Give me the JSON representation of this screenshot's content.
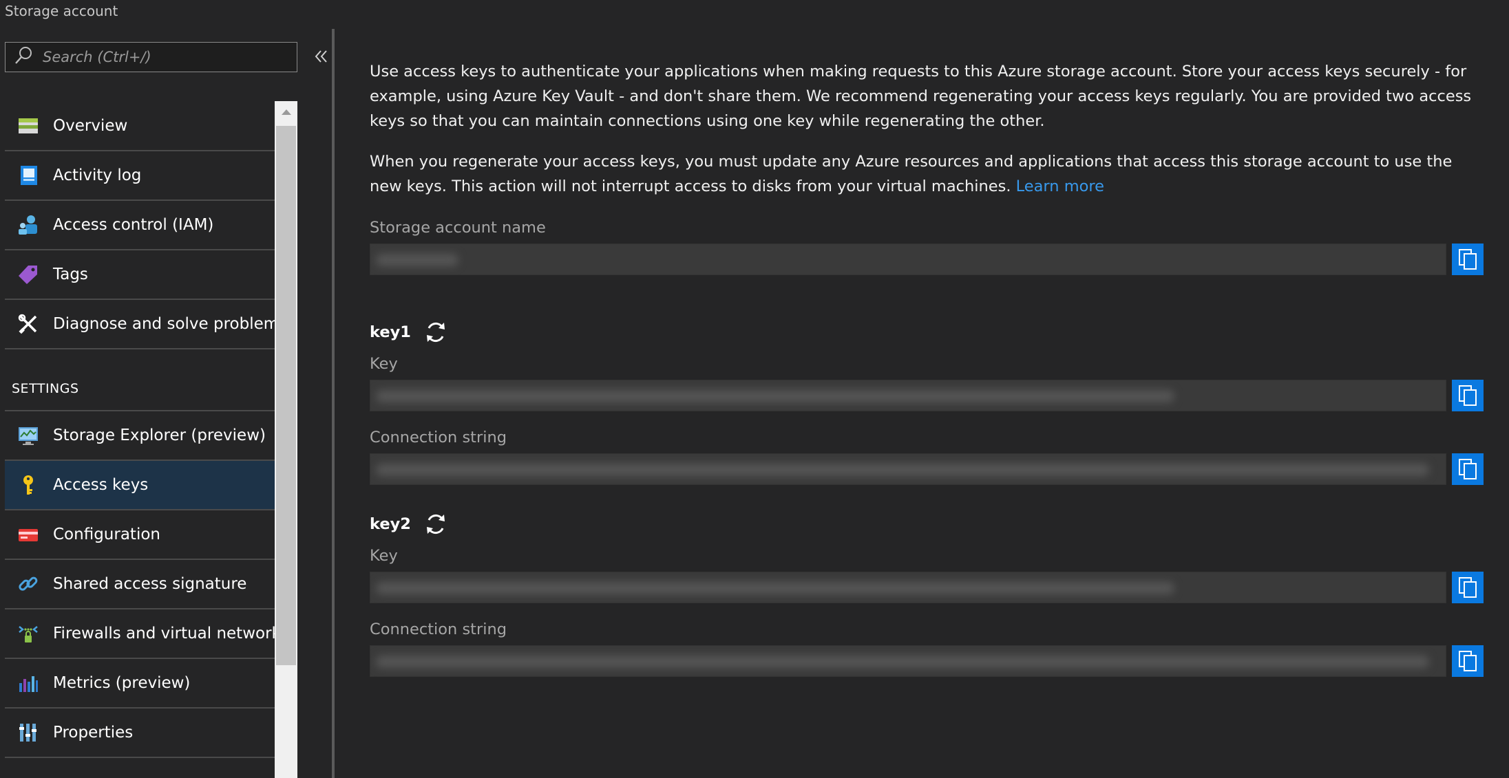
{
  "header": {
    "subtitle": "Storage account"
  },
  "search": {
    "placeholder": "Search (Ctrl+/)"
  },
  "menu": {
    "items_top": [
      {
        "label": "Overview",
        "icon": "overview-icon"
      },
      {
        "label": "Activity log",
        "icon": "activity-log-icon"
      },
      {
        "label": "Access control (IAM)",
        "icon": "iam-icon"
      },
      {
        "label": "Tags",
        "icon": "tag-icon"
      },
      {
        "label": "Diagnose and solve problems",
        "icon": "wrench-icon"
      }
    ],
    "settings_heading": "SETTINGS",
    "items_settings": [
      {
        "label": "Storage Explorer (preview)",
        "icon": "storage-explorer-icon"
      },
      {
        "label": "Access keys",
        "icon": "key-icon",
        "active": true
      },
      {
        "label": "Configuration",
        "icon": "configuration-icon"
      },
      {
        "label": "Shared access signature",
        "icon": "link-icon"
      },
      {
        "label": "Firewalls and virtual networks",
        "icon": "firewall-icon"
      },
      {
        "label": "Metrics (preview)",
        "icon": "metrics-icon"
      },
      {
        "label": "Properties",
        "icon": "properties-icon"
      }
    ]
  },
  "main": {
    "intro": "Use access keys to authenticate your applications when making requests to this Azure storage account. Store your access keys securely - for example, using Azure Key Vault - and don't share them. We recommend regenerating your access keys regularly. You are provided two access keys so that you can maintain connections using one key while regenerating the other.",
    "regen_note": "When you regenerate your access keys, you must update any Azure resources and applications that access this storage account to use the new keys. This action will not interrupt access to disks from your virtual machines.",
    "learn_more": "Learn more",
    "account_name_label": "Storage account name",
    "key1": {
      "title": "key1",
      "key_label": "Key",
      "conn_label": "Connection string"
    },
    "key2": {
      "title": "key2",
      "key_label": "Key",
      "conn_label": "Connection string"
    }
  },
  "colors": {
    "accent": "#0a79e0",
    "link": "#3899ec",
    "active_item": "#1d3348",
    "background": "#252526"
  }
}
